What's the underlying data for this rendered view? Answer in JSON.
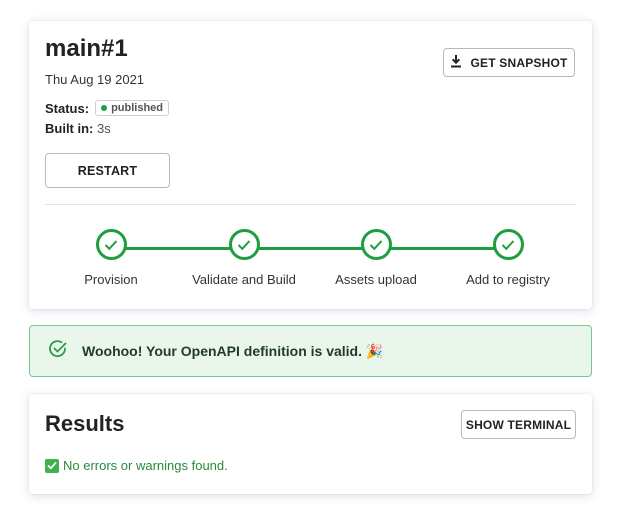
{
  "build": {
    "title": "main#1",
    "date": "Thu Aug 19 2021",
    "status_label": "Status:",
    "status_value": "published",
    "built_label": "Built in:",
    "built_value": "3s",
    "snapshot_label": "GET SNAPSHOT",
    "restart_label": "RESTART",
    "steps": [
      {
        "label": "Provision",
        "state": "complete"
      },
      {
        "label": "Validate and Build",
        "state": "complete"
      },
      {
        "label": "Assets upload",
        "state": "complete"
      },
      {
        "label": "Add to registry",
        "state": "complete"
      }
    ]
  },
  "alert": {
    "message": "Woohoo! Your OpenAPI definition is valid. 🎉"
  },
  "results": {
    "title": "Results",
    "terminal_label": "SHOW TERMINAL",
    "message": "No errors or warnings found."
  },
  "colors": {
    "success": "#1e9e3e",
    "alert_bg": "#e9f6ec"
  }
}
